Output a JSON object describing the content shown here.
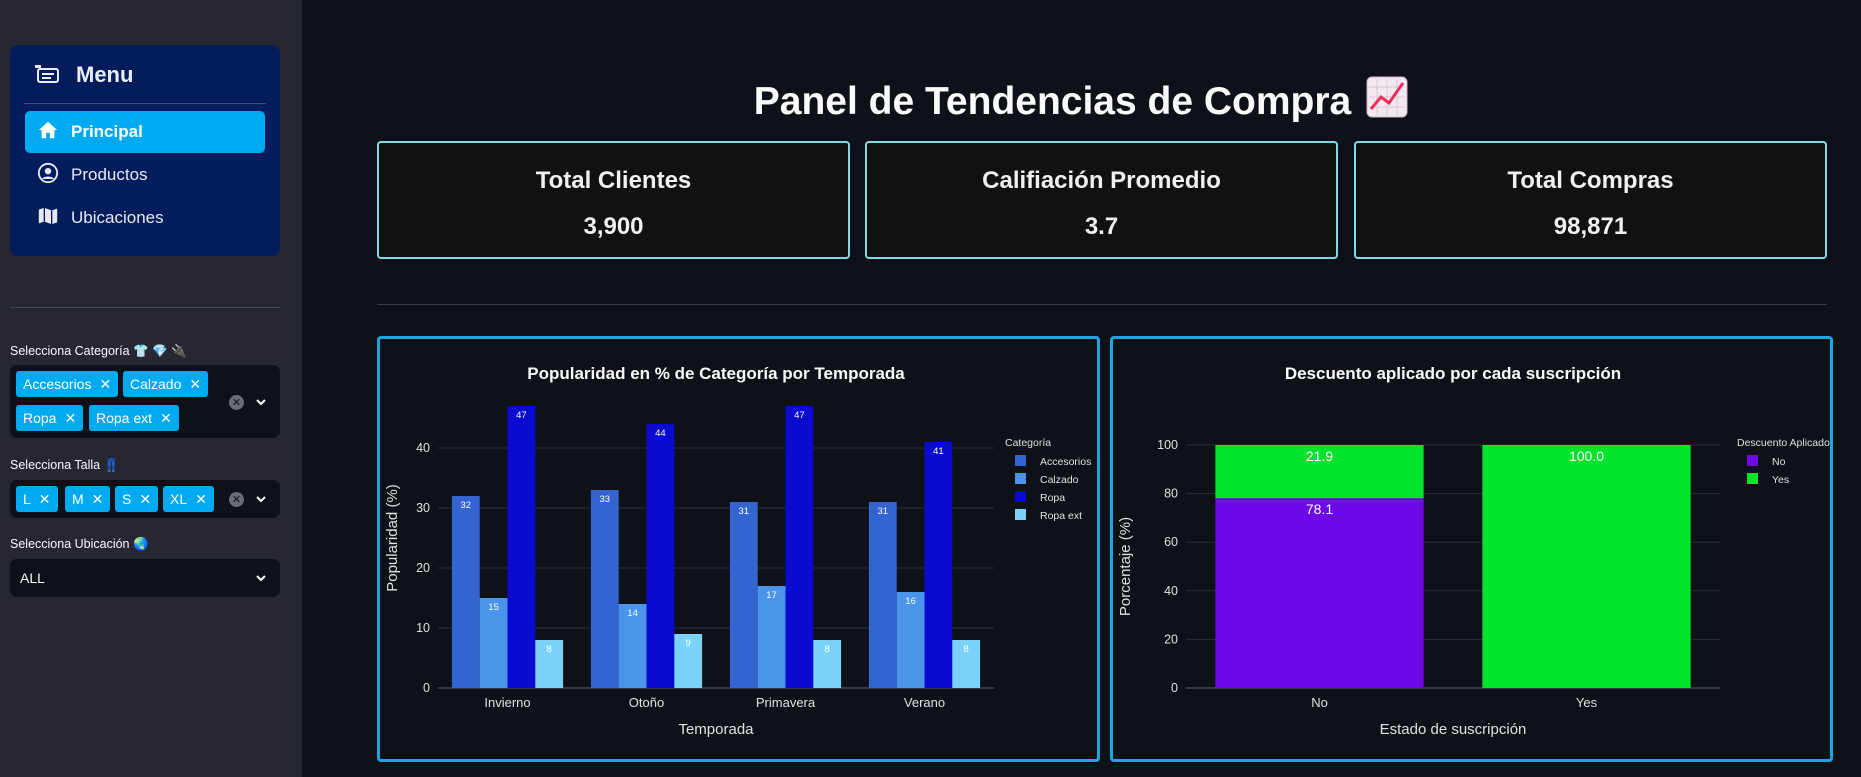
{
  "sidebar": {
    "menu_title": "Menu",
    "items": [
      {
        "label": "Principal",
        "icon": "home-icon",
        "active": true
      },
      {
        "label": "Productos",
        "icon": "user-circle-icon",
        "active": false
      },
      {
        "label": "Ubicaciones",
        "icon": "map-icon",
        "active": false
      }
    ],
    "filters": {
      "category": {
        "label": "Selecciona Categoría 👕 💎 🔌",
        "tags": [
          "Accesorios",
          "Calzado",
          "Ropa",
          "Ropa ext"
        ]
      },
      "size": {
        "label": "Selecciona Talla 👖",
        "tags": [
          "L",
          "M",
          "S",
          "XL"
        ]
      },
      "location": {
        "label": "Selecciona Ubicación 🌏",
        "value": "ALL"
      }
    }
  },
  "header": {
    "title": "Panel de Tendencias de Compra",
    "title_icon": "chart-increasing-icon"
  },
  "kpis": [
    {
      "label": "Total Clientes",
      "value": "3,900"
    },
    {
      "label": "Califiación Promedio",
      "value": "3.7"
    },
    {
      "label": "Total Compras",
      "value": "98,871"
    }
  ],
  "chart_data": [
    {
      "type": "bar",
      "title": "Popularidad en % de Categoría por Temporada",
      "xlabel": "Temporada",
      "ylabel": "Popularidad (%)",
      "categories": [
        "Invierno",
        "Otoño",
        "Primavera",
        "Verano"
      ],
      "legend_title": "Categoría",
      "legend_position": "top-right",
      "ylim": [
        0,
        50
      ],
      "yticks": [
        0,
        10,
        20,
        30,
        40
      ],
      "grid": true,
      "series": [
        {
          "name": "Accesorios",
          "values": [
            32,
            33,
            31,
            31
          ],
          "color": "#3464d0"
        },
        {
          "name": "Calzado",
          "values": [
            15,
            14,
            17,
            16
          ],
          "color": "#4a94ea"
        },
        {
          "name": "Ropa",
          "values": [
            47,
            44,
            47,
            41
          ],
          "color": "#0a0ad0"
        },
        {
          "name": "Ropa ext",
          "values": [
            8,
            9,
            8,
            8
          ],
          "color": "#7ad2f8"
        }
      ]
    },
    {
      "type": "bar",
      "stacked": true,
      "title": "Descuento aplicado por cada suscripción",
      "xlabel": "Estado de suscripción",
      "ylabel": "Porcentaje (%)",
      "categories": [
        "No",
        "Yes"
      ],
      "legend_title": "Descuento Aplicado",
      "legend_position": "top-right",
      "ylim": [
        0,
        100
      ],
      "yticks": [
        0,
        20,
        40,
        60,
        80,
        100
      ],
      "grid": true,
      "series": [
        {
          "name": "No",
          "values": [
            78.1,
            0
          ],
          "labels": [
            "78.1",
            ""
          ],
          "color": "#6e0ae8"
        },
        {
          "name": "Yes",
          "values": [
            21.9,
            100.0
          ],
          "labels": [
            "21.9",
            "100.0"
          ],
          "color": "#00e52c"
        }
      ]
    }
  ]
}
